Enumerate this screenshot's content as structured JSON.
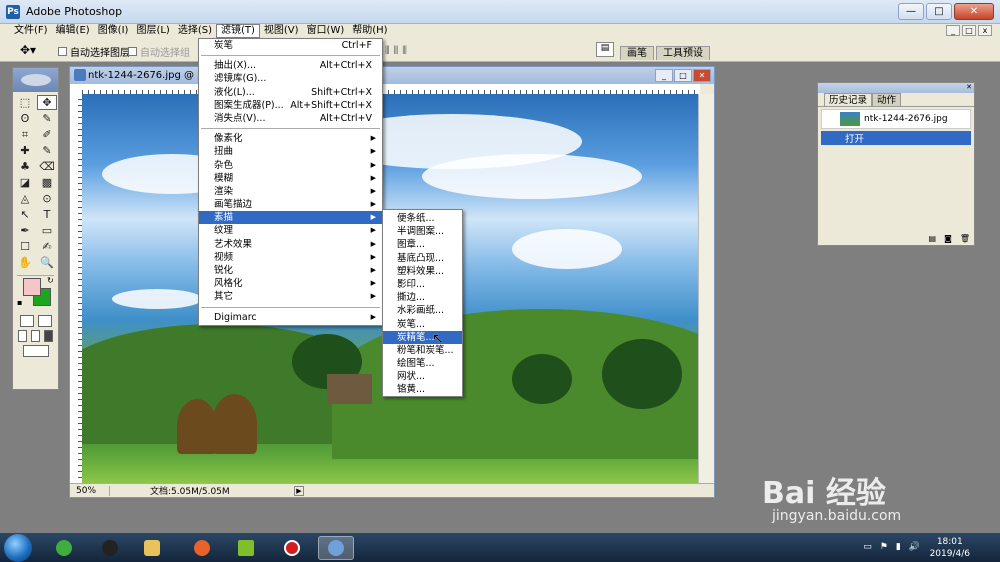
{
  "window": {
    "title": "Adobe Photoshop",
    "logo_text": "Ps",
    "buttons": [
      "—",
      "□",
      "✕"
    ]
  },
  "menubar": {
    "items": [
      "文件(F)",
      "编辑(E)",
      "图像(I)",
      "图层(L)",
      "选择(S)",
      "滤镜(T)",
      "视图(V)",
      "窗口(W)",
      "帮助(H)"
    ],
    "active_index": 5,
    "mdi_buttons": [
      "_",
      "□",
      "x"
    ]
  },
  "options": {
    "auto_select_layer": "自动选择图层",
    "auto_select_group": "自动选择组",
    "palette_well_icon": "palette-icon",
    "well_tabs": [
      "画笔",
      "工具预设"
    ]
  },
  "toolbox": {
    "tools": [
      "⬚",
      "✥",
      "ʘ",
      "✎",
      "⌗",
      "✐",
      "✚",
      "✎",
      "♣",
      "⌫",
      "◪",
      "▩",
      "◬",
      "⊙",
      "↖",
      "T",
      "✒",
      "▭",
      "☐",
      "✍",
      "✋",
      "🔍"
    ],
    "selected_index": 1
  },
  "document": {
    "title": "ntk-1244-2676.jpg @ 50%",
    "zoom": "50%",
    "doc_size": "文档:5.05M/5.05M",
    "buttons": [
      "_",
      "□",
      "✕"
    ]
  },
  "filter_menu": {
    "rows": [
      {
        "label": "炭笔",
        "shortcut": "Ctrl+F",
        "sub": false
      },
      {
        "sep": true
      },
      {
        "label": "抽出(X)...",
        "shortcut": "Alt+Ctrl+X",
        "sub": false
      },
      {
        "label": "滤镜库(G)...",
        "shortcut": "",
        "sub": false
      },
      {
        "label": "液化(L)...",
        "shortcut": "Shift+Ctrl+X",
        "sub": false
      },
      {
        "label": "图案生成器(P)...",
        "shortcut": "Alt+Shift+Ctrl+X",
        "sub": false
      },
      {
        "label": "消失点(V)...",
        "shortcut": "Alt+Ctrl+V",
        "sub": false
      },
      {
        "sep": true
      },
      {
        "label": "像素化",
        "shortcut": "",
        "sub": true
      },
      {
        "label": "扭曲",
        "shortcut": "",
        "sub": true
      },
      {
        "label": "杂色",
        "shortcut": "",
        "sub": true
      },
      {
        "label": "模糊",
        "shortcut": "",
        "sub": true
      },
      {
        "label": "渲染",
        "shortcut": "",
        "sub": true
      },
      {
        "label": "画笔描边",
        "shortcut": "",
        "sub": true
      },
      {
        "label": "素描",
        "shortcut": "",
        "sub": true,
        "highlight": true
      },
      {
        "label": "纹理",
        "shortcut": "",
        "sub": true
      },
      {
        "label": "艺术效果",
        "shortcut": "",
        "sub": true
      },
      {
        "label": "视频",
        "shortcut": "",
        "sub": true
      },
      {
        "label": "锐化",
        "shortcut": "",
        "sub": true
      },
      {
        "label": "风格化",
        "shortcut": "",
        "sub": true
      },
      {
        "label": "其它",
        "shortcut": "",
        "sub": true
      },
      {
        "sep": true
      },
      {
        "label": "Digimarc",
        "shortcut": "",
        "sub": true
      }
    ]
  },
  "sketch_submenu": {
    "items": [
      "便条纸...",
      "半调图案...",
      "图章...",
      "基底凸现...",
      "塑料效果...",
      "影印...",
      "撕边...",
      "水彩画纸...",
      "炭笔...",
      "炭精笔...",
      "粉笔和炭笔...",
      "绘图笔...",
      "网状...",
      "铬黄..."
    ],
    "highlight_index": 9
  },
  "history": {
    "tabs": [
      "历史记录",
      "动作"
    ],
    "snapshot": "ntk-1244-2676.jpg",
    "state": "打开"
  },
  "taskbar": {
    "clock_time": "18:01",
    "clock_date": "2019/4/6"
  },
  "watermark": {
    "logo": "Bai 经验",
    "url": "jingyan.baidu.com"
  },
  "colors": {
    "foreground": "#f5c6c6",
    "background": "#1ea51e",
    "highlight": "#316ac5"
  }
}
